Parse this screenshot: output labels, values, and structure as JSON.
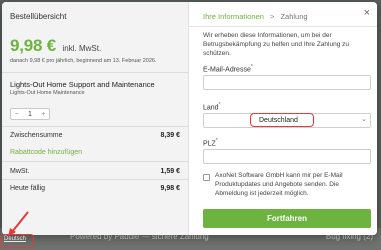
{
  "order": {
    "title": "Bestellübersicht",
    "price": "9,98 €",
    "price_tax_note": "inkl. MwSt.",
    "recurring_note": "danach 9,98 € pro jährlich, beginnend am 13. Februar 2026.",
    "product_name": "Lights-Out Home Support and Maintenance",
    "product_sub": "Lights-Out Home Maintenance",
    "quantity": {
      "minus": "−",
      "value": "1",
      "plus": "+"
    },
    "subtotal_label": "Zwischensumme",
    "subtotal_value": "8,39 €",
    "coupon_link": "Rabattcode hinzufügen",
    "tax_label": "MwSt.",
    "tax_value": "1,59 €",
    "due_label": "Heute fällig",
    "due_value": "9,98 €"
  },
  "checkout": {
    "breadcrumb": {
      "info": "Ihre Informationen",
      "separator": ">",
      "payment": "Zahlung"
    },
    "close_glyph": "×",
    "intro": "Wir erheben diese Informationen, um bei der Betrugsbekämpfung zu helfen und Ihre Zahlung zu schützen.",
    "email_label": "E-Mail-Adresse",
    "country_label": "Land",
    "country_value": "Deutschland",
    "plz_label": "PLZ",
    "required_mark": "*",
    "consent_text": "AxoNet Software GmbH kann mir per E-Mail Produktupdates und Angebote senden. Die Abmeldung ist jederzeit möglich.",
    "continue_label": "Fortfahren",
    "chevron_glyph": "⌄"
  },
  "footer": {
    "language": "Deutsch",
    "bg_text": "Powered by Paddle — sichere Zahlung",
    "bg_right": "Bug fixing (2)"
  },
  "colors": {
    "accent": "#6db33f",
    "highlight": "#e23b3b"
  }
}
